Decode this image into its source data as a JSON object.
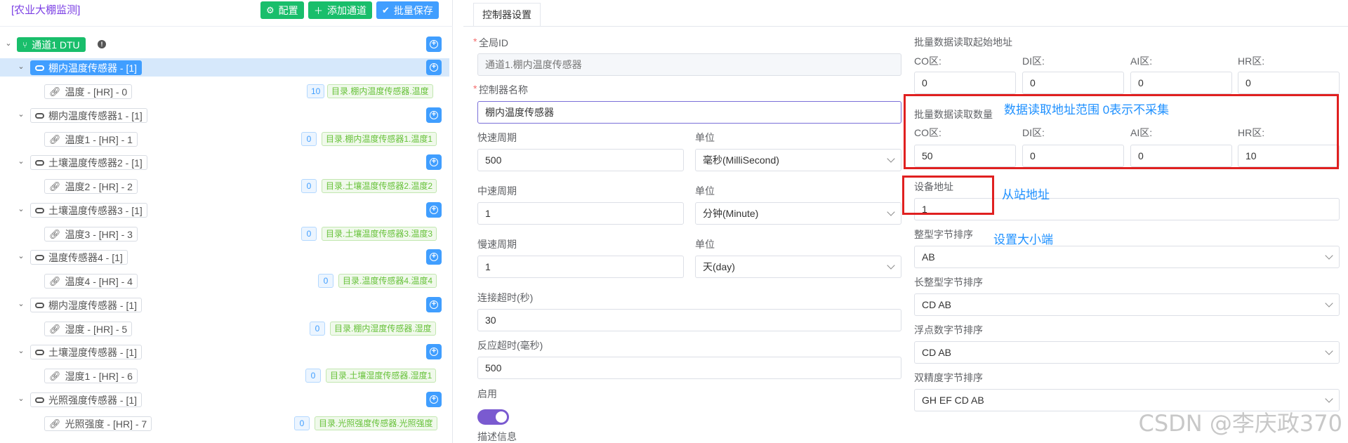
{
  "app_title": "[农业大棚监测]",
  "toolbar": {
    "config_label": "配置",
    "add_channel_label": "添加通道",
    "batch_save_label": "批量保存"
  },
  "tree": {
    "root_label": "通道1 DTU",
    "devices": [
      {
        "label": "棚内温度传感器 - [1]",
        "point": "温度 - [HR] - 0",
        "value": "10",
        "path": "目录.棚内温度传感器.温度"
      },
      {
        "label": "棚内温度传感器1 - [1]",
        "point": "温度1 - [HR] - 1",
        "value": "0",
        "path": "目录.棚内温度传感器1.温度1"
      },
      {
        "label": "土壤温度传感器2 - [1]",
        "point": "温度2 - [HR] - 2",
        "value": "0",
        "path": "目录.土壤温度传感器2.温度2"
      },
      {
        "label": "土壤温度传感器3 - [1]",
        "point": "温度3 - [HR] - 3",
        "value": "0",
        "path": "目录.土壤温度传感器3.温度3"
      },
      {
        "label": "温度传感器4 - [1]",
        "point": "温度4 - [HR] - 4",
        "value": "0",
        "path": "目录.温度传感器4.温度4"
      },
      {
        "label": "棚内湿度传感器 - [1]",
        "point": "湿度 - [HR] - 5",
        "value": "0",
        "path": "目录.棚内湿度传感器.湿度"
      },
      {
        "label": "土壤湿度传感器 - [1]",
        "point": "湿度1 - [HR] - 6",
        "value": "0",
        "path": "目录.土壤湿度传感器.湿度1"
      },
      {
        "label": "光照强度传感器 - [1]",
        "point": "光照强度 - [HR] - 7",
        "value": "0",
        "path": "目录.光照强度传感器.光照强度"
      }
    ]
  },
  "tab_label": "控制器设置",
  "form": {
    "global_id_label": "全局ID",
    "global_id_value": "通道1.棚内温度传感器",
    "name_label": "控制器名称",
    "name_value": "棚内温度传感器",
    "fast_label": "快速周期",
    "fast_value": "500",
    "unit_label": "单位",
    "fast_unit": "毫秒(MilliSecond)",
    "mid_label": "中速周期",
    "mid_value": "1",
    "mid_unit": "分钟(Minute)",
    "slow_label": "慢速周期",
    "slow_value": "1",
    "slow_unit": "天(day)",
    "conn_timeout_label": "连接超时(秒)",
    "conn_timeout_value": "30",
    "resp_timeout_label": "反应超时(毫秒)",
    "resp_timeout_value": "500",
    "enable_label": "启用",
    "enable_on": true,
    "desc_label": "描述信息"
  },
  "batch": {
    "start_title": "批量数据读取起始地址",
    "count_title": "批量数据读取数量",
    "co_label": "CO区:",
    "di_label": "DI区:",
    "ai_label": "AI区:",
    "hr_label": "HR区:",
    "start_co": "0",
    "start_di": "0",
    "start_ai": "0",
    "start_hr": "0",
    "count_co": "50",
    "count_di": "0",
    "count_ai": "0",
    "count_hr": "10"
  },
  "device_addr_label": "设备地址",
  "device_addr_value": "1",
  "int_order_label": "整型字节排序",
  "int_order_value": "AB",
  "long_order_label": "长整型字节排序",
  "long_order_value": "CD AB",
  "float_order_label": "浮点数字节排序",
  "float_order_value": "CD AB",
  "double_order_label": "双精度字节排序",
  "double_order_value": "GH EF CD AB",
  "annotations": {
    "range_note": "数据读取地址范围  0表示不采集",
    "slave_note": "从站地址",
    "endian_note": "设置大小端"
  },
  "watermark": "CSDN @李庆政370",
  "colors": {
    "accent_blue": "#409eff",
    "green": "#19be6b",
    "title_purple": "#7b3fe4",
    "annotation_red": "#e02020",
    "annotation_blue": "#1e90ff",
    "toggle_on": "#7a5ad0"
  }
}
